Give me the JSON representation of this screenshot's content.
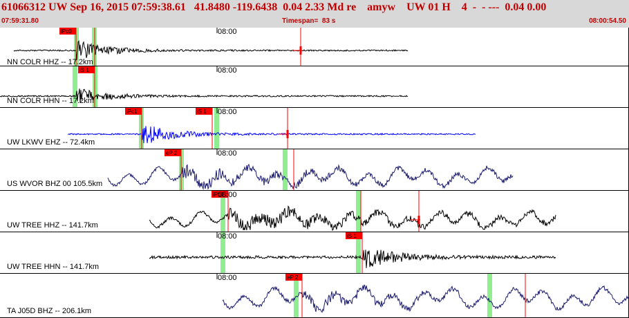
{
  "header": {
    "event_line": "61066312 UW Sep 16, 2015 07:59:38.61   41.8480 -119.6438  0.04 2.33 Md re    amyw    UW 01 H    4  -  - ---  0.04 0.00",
    "start_time": "07:59:31.80",
    "timespan": "Timespan=  83 s",
    "end_time": "08:00:54.50"
  },
  "time_tick_label": "08:00",
  "channels": [
    {
      "label": "NN COLR HHZ -- 17.2km",
      "trace_color": "#000000",
      "style": "hf",
      "amp": 5,
      "quiet_amp": 1,
      "start": 20,
      "end": 590,
      "onset": 110,
      "burst_amp": 15,
      "green": [
        110,
        136
      ],
      "picks": [
        {
          "label": "iPc0",
          "pos": 110
        },
        {
          "label": "",
          "pos": 137
        }
      ],
      "marker": 435
    },
    {
      "label": "NN COLR HHN -- 17.2km",
      "trace_color": "#000000",
      "style": "hf",
      "amp": 5,
      "quiet_amp": 1,
      "start": 0,
      "end": 590,
      "onset": 108,
      "burst_amp": 12,
      "green": [
        108,
        137
      ],
      "picks": [
        {
          "label": "iS 1",
          "pos": 137
        }
      ],
      "marker": null
    },
    {
      "label": "UW LKWV EHZ -- 72.4km",
      "trace_color": "#0000ff",
      "style": "hf",
      "amp": 5,
      "quiet_amp": 1,
      "start": 98,
      "end": 688,
      "onset": 205,
      "burst_amp": 16,
      "green": [
        204,
        313
      ],
      "picks": [
        {
          "label": "iPc1",
          "pos": 205
        },
        {
          "label": "iS 1",
          "pos": 307
        }
      ],
      "marker": 416
    },
    {
      "label": "US WVOR BHZ 00 105.5km",
      "trace_color": "#1a1a6e",
      "style": "lf",
      "amp": 18,
      "quiet_amp": 4,
      "start": 156,
      "end": 742,
      "onset": 262,
      "burst_amp": 10,
      "green": [
        262,
        412
      ],
      "picks": [
        {
          "label": "eP 2",
          "pos": 262
        },
        {
          "label": "",
          "pos": 425
        }
      ],
      "marker": null
    },
    {
      "label": "UW TREE HHZ -- 141.7km",
      "trace_color": "#000000",
      "style": "lf",
      "amp": 16,
      "quiet_amp": 4,
      "start": 216,
      "end": 804,
      "onset": 330,
      "burst_amp": 12,
      "green": [
        322,
        518
      ],
      "picks": [
        {
          "label": "iPc1",
          "pos": 330
        },
        {
          "label": "",
          "pos": 522
        }
      ],
      "marker": 606
    },
    {
      "label": "UW TREE HHN -- 141.7km",
      "trace_color": "#000000",
      "style": "hf",
      "amp": 4,
      "quiet_amp": 2,
      "start": 216,
      "end": 804,
      "onset": 524,
      "burst_amp": 16,
      "green": [
        322,
        518
      ],
      "picks": [
        {
          "label": "iS 1",
          "pos": 524
        }
      ],
      "marker": null
    },
    {
      "label": "TA J05D BHZ -- 206.1km",
      "trace_color": "#1a1a6e",
      "style": "lf",
      "amp": 20,
      "quiet_amp": 5,
      "start": 322,
      "end": 909,
      "onset": 437,
      "burst_amp": 8,
      "green": [
        428,
        708
      ],
      "picks": [
        {
          "label": "eP 2",
          "pos": 437
        },
        {
          "label": "",
          "pos": 760
        }
      ],
      "marker": null
    }
  ]
}
